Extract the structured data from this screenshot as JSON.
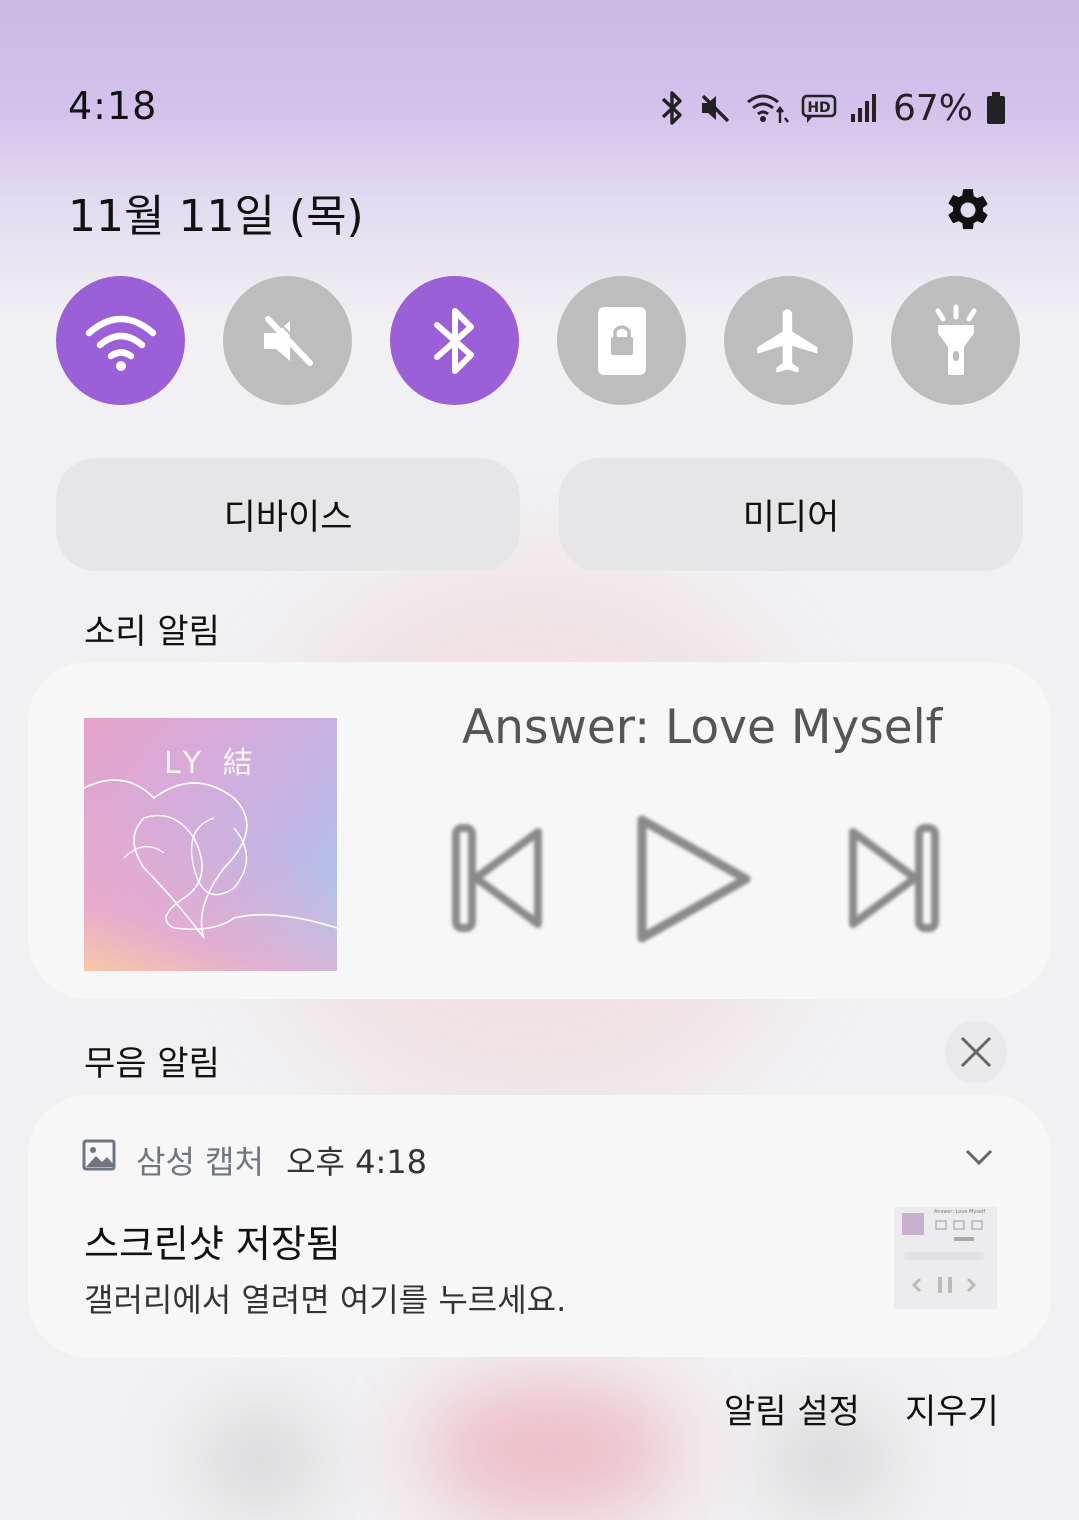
{
  "status_bar": {
    "time": "4:18",
    "battery_percent": "67%",
    "icons": [
      "bluetooth-icon",
      "mute-icon",
      "wifi-data-icon",
      "hd-voice-icon",
      "signal-icon",
      "battery-icon"
    ]
  },
  "header": {
    "date": "11월 11일 (목)",
    "settings_icon": "gear-icon"
  },
  "quick_settings": [
    {
      "name": "wifi",
      "icon": "wifi-icon",
      "state": "on"
    },
    {
      "name": "sound",
      "icon": "mute-icon",
      "state": "off"
    },
    {
      "name": "bluetooth",
      "icon": "bluetooth-icon",
      "state": "on"
    },
    {
      "name": "auto-rotate",
      "icon": "rotation-lock-icon",
      "state": "off"
    },
    {
      "name": "airplane-mode",
      "icon": "airplane-icon",
      "state": "off"
    },
    {
      "name": "flashlight",
      "icon": "flashlight-icon",
      "state": "off"
    }
  ],
  "pills": {
    "devices": "디바이스",
    "media": "미디어"
  },
  "sections": {
    "sound": "소리 알림",
    "silent": "무음 알림"
  },
  "media_player": {
    "track_title": "Answer: Love Myself",
    "album_logo": "LY 結",
    "controls": [
      "previous-icon",
      "play-icon",
      "next-icon"
    ]
  },
  "notification": {
    "app_name": "삼성 캡처",
    "time": "오후 4:18",
    "title": "스크린샷 저장됨",
    "body": "갤러리에서 열려면 여기를 누르세요.",
    "thumbnail_title": "Answer: Love Myself"
  },
  "footer": {
    "notification_settings": "알림 설정",
    "clear": "지우기"
  },
  "colors": {
    "accent": "#9b5fd8",
    "tile_off": "#bdbdbd"
  }
}
